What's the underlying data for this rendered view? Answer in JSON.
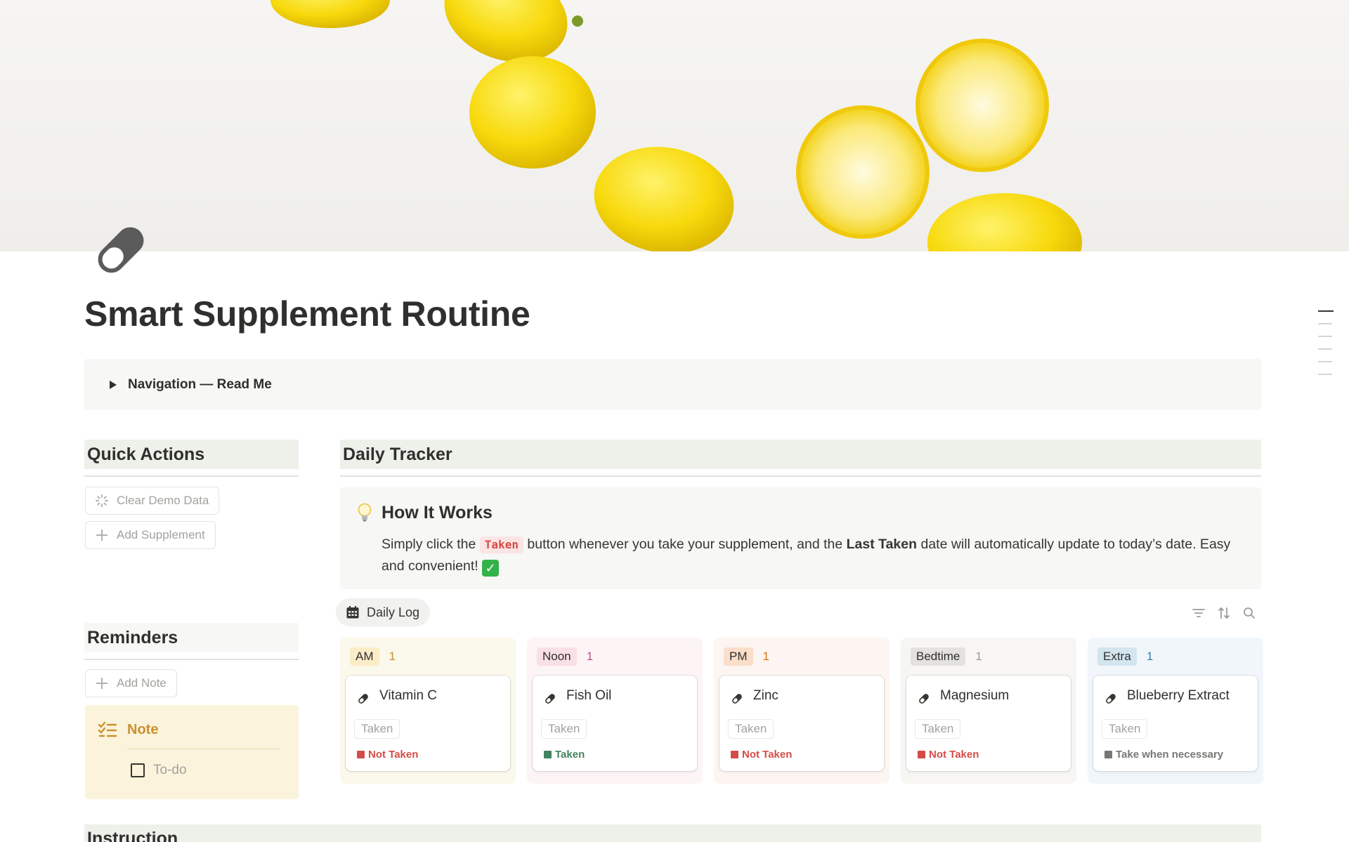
{
  "page": {
    "title": "Smart Supplement Routine",
    "toggle_label": "Navigation — Read Me"
  },
  "quick_actions": {
    "heading": "Quick Actions",
    "clear_demo": "Clear Demo Data",
    "add_supplement": "Add Supplement"
  },
  "reminders": {
    "heading": "Reminders",
    "add_note": "Add Note",
    "note_title": "Note",
    "todo": "To-do"
  },
  "daily_tracker": {
    "heading": "Daily Tracker",
    "callout": {
      "title": "How It Works",
      "text_1": "Simply click the",
      "pill": "Taken",
      "text_2": "button whenever you take your supplement, and the",
      "bold": "Last Taken",
      "text_3": "date will automatically update to today’s date. Easy and convenient!",
      "emoji": "✓"
    },
    "view_tab": "Daily Log",
    "toolbar_icons": [
      "filter-icon",
      "sort-icon",
      "search-icon"
    ]
  },
  "board": {
    "columns": [
      {
        "tag": "AM",
        "count": "1",
        "card": {
          "name": "Vitamin C",
          "button": "Taken",
          "status": "Not Taken"
        }
      },
      {
        "tag": "Noon",
        "count": "1",
        "card": {
          "name": "Fish Oil",
          "button": "Taken",
          "status": "Taken"
        }
      },
      {
        "tag": "PM",
        "count": "1",
        "card": {
          "name": "Zinc",
          "button": "Taken",
          "status": "Not Taken"
        }
      },
      {
        "tag": "Bedtime",
        "count": "1",
        "card": {
          "name": "Magnesium",
          "button": "Taken",
          "status": "Not Taken"
        }
      },
      {
        "tag": "Extra",
        "count": "1",
        "card": {
          "name": "Blueberry Extract",
          "button": "Taken",
          "status": "Take when necessary"
        }
      }
    ]
  },
  "instruction": {
    "heading": "Instruction"
  },
  "colors": {
    "heading_bg": "#eef1ea",
    "not_taken": "#d44c47",
    "taken": "#448361",
    "neutral": "#787774",
    "note_bg": "#fbf3db"
  }
}
